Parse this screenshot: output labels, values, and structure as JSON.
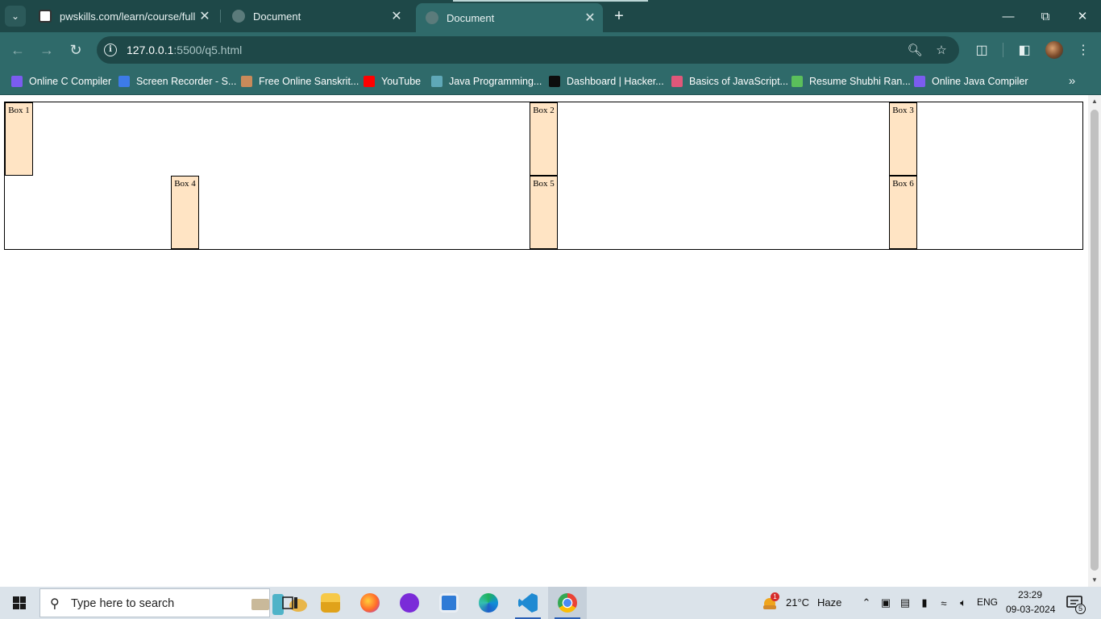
{
  "browser": {
    "tabs": [
      {
        "title": "pwskills.com/learn/course/full-s",
        "favicon": "pwskills-icon",
        "active": false
      },
      {
        "title": "Document",
        "favicon": "globe-icon",
        "active": false
      },
      {
        "title": "Document",
        "favicon": "globe-icon",
        "active": true
      }
    ],
    "address": {
      "host": "127.0.0.1",
      "path": ":5500/q5.html"
    },
    "bookmarks": [
      {
        "label": "Online C Compiler"
      },
      {
        "label": "Screen Recorder - S..."
      },
      {
        "label": "Free Online Sanskrit..."
      },
      {
        "label": "YouTube"
      },
      {
        "label": "Java Programming..."
      },
      {
        "label": "Dashboard | Hacker..."
      },
      {
        "label": "Basics of JavaScript..."
      },
      {
        "label": "Resume Shubhi Ran..."
      },
      {
        "label": "Online Java Compiler"
      }
    ]
  },
  "page": {
    "boxes": [
      {
        "label": "Box 1"
      },
      {
        "label": "Box 2"
      },
      {
        "label": "Box 3"
      },
      {
        "label": "Box 4"
      },
      {
        "label": "Box 5"
      },
      {
        "label": "Box 6"
      }
    ]
  },
  "taskbar": {
    "search_placeholder": "Type here to search",
    "weather": {
      "temp": "21°C",
      "condition": "Haze",
      "badge": "1"
    },
    "language": "ENG",
    "time": "23:29",
    "date": "09-03-2024",
    "notification_count": "5"
  },
  "colors": {
    "tabstrip": "#1e4848",
    "toolbar": "#2f6a6a",
    "box_fill": "#ffe4c4",
    "taskbar": "#dbe3ea"
  }
}
